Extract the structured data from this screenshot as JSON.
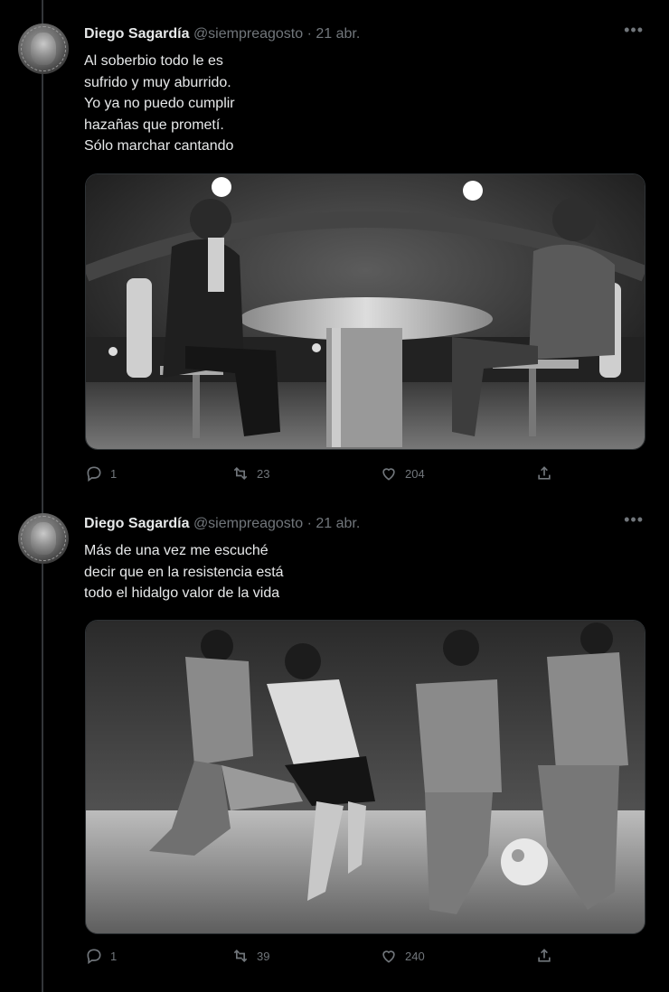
{
  "tweets": [
    {
      "author": "Diego Sagardía",
      "handle": "@siempreagosto",
      "separator": "·",
      "date": "21 abr.",
      "text_lines": [
        "Al soberbio todo le es",
        "sufrido y muy aburrido.",
        "Yo ya no puedo cumplir",
        "hazañas que prometí.",
        "Sólo marchar cantando"
      ],
      "media_icon": "tv-interview-photo",
      "replies": "1",
      "retweets": "23",
      "likes": "204"
    },
    {
      "author": "Diego Sagardía",
      "handle": "@siempreagosto",
      "separator": "·",
      "date": "21 abr.",
      "text_lines": [
        "Más de una vez me escuché",
        "decir que en la resistencia está",
        "todo el hidalgo valor de la vida"
      ],
      "media_icon": "football-match-photo",
      "replies": "1",
      "retweets": "39",
      "likes": "240"
    }
  ],
  "icons": {
    "more": "more-icon",
    "reply": "reply-icon",
    "retweet": "retweet-icon",
    "like": "like-icon",
    "share": "share-icon"
  },
  "colors": {
    "background": "#000000",
    "text": "#e7e9ea",
    "muted": "#71767b",
    "border": "#2f3336"
  }
}
